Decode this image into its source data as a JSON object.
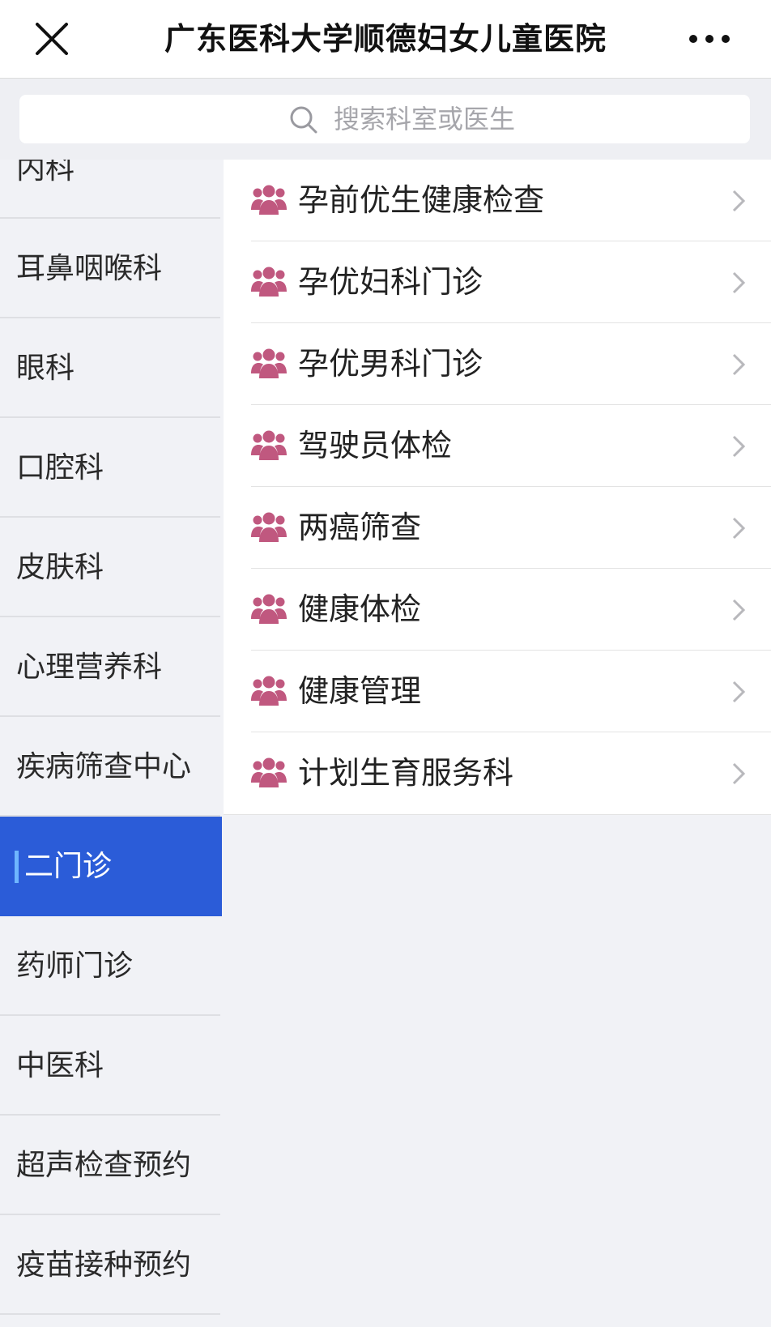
{
  "header": {
    "title": "广东医科大学顺德妇女儿童医院",
    "close_icon": "close-icon",
    "more_icon": "more-dots-icon"
  },
  "search": {
    "placeholder": "搜索科室或医生",
    "icon": "search-icon"
  },
  "sidebar": {
    "active_color": "#2b5cd8",
    "items": [
      {
        "label": "内科"
      },
      {
        "label": "耳鼻咽喉科"
      },
      {
        "label": "眼科"
      },
      {
        "label": "口腔科"
      },
      {
        "label": "皮肤科"
      },
      {
        "label": "心理营养科"
      },
      {
        "label": "疾病筛查中心"
      },
      {
        "label": "二门诊",
        "active": true
      },
      {
        "label": "药师门诊"
      },
      {
        "label": "中医科"
      },
      {
        "label": "超声检查预约"
      },
      {
        "label": "疫苗接种预约"
      }
    ]
  },
  "departments": {
    "icon": "people-group-icon",
    "icon_color": "#c0587f",
    "items": [
      {
        "label": "孕前优生健康检查"
      },
      {
        "label": "孕优妇科门诊"
      },
      {
        "label": "孕优男科门诊"
      },
      {
        "label": "驾驶员体检"
      },
      {
        "label": "两癌筛查"
      },
      {
        "label": "健康体检"
      },
      {
        "label": "健康管理"
      },
      {
        "label": "计划生育服务科"
      }
    ]
  }
}
